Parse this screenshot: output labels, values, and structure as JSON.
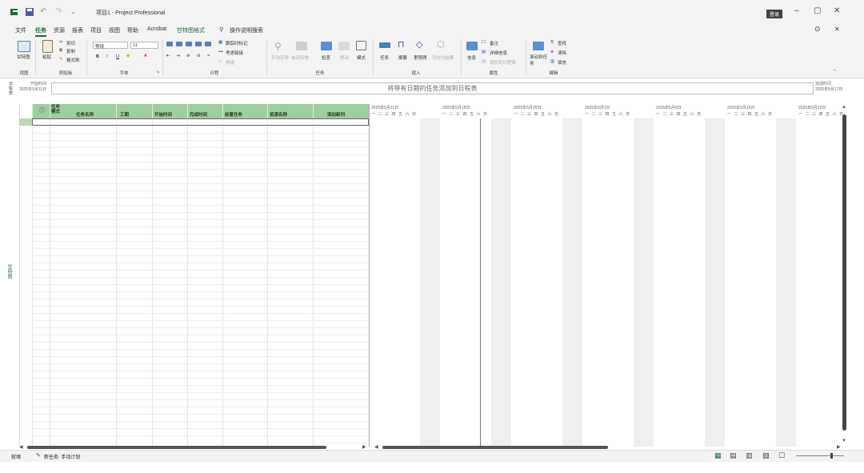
{
  "window": {
    "title": "项目1  -  Project Professional",
    "sign_in": "登录"
  },
  "menu": [
    "文件",
    "任务",
    "资源",
    "报表",
    "项目",
    "视图",
    "帮助",
    "Acrobat",
    "甘特图格式",
    "操作说明搜索"
  ],
  "active_menu": "任务",
  "ribbon": {
    "groups": {
      "view": "视图",
      "clipboard": "剪贴板",
      "font": "字体",
      "schedule": "日程",
      "tasks": "任务",
      "insert": "插入",
      "properties": "属性",
      "editing": "编辑"
    },
    "view_btn": "甘特图",
    "paste": "粘贴",
    "cut": "剪切",
    "copy": "复制",
    "format_painter": "格式刷",
    "font_name": "等线",
    "font_size": "11",
    "mark_on_track": "跟踪时标记",
    "respect_links": "考虑链接",
    "inactivate": "停用",
    "manual_schedule": "手动安排",
    "auto_schedule": "自动安排",
    "inspect": "检查",
    "move": "移动",
    "mode": "模式",
    "task": "任务",
    "summary": "摘要",
    "milestone": "里程碑",
    "deliverable": "可交付结果",
    "information": "信息",
    "notes": "备注",
    "details": "详细信息",
    "add_to_timeline": "添加到日程表",
    "scroll_to_task": "滚动到任务",
    "find": "查找",
    "clear": "清除",
    "fill": "填充"
  },
  "timeline": {
    "start_label": "开始时间",
    "start_date": "2025年5月11日",
    "finish_label": "完成时间",
    "finish_date": "2025年5月17日",
    "placeholder": "将带有日期的任务添加到日程表",
    "side_label": "日程表"
  },
  "grid": {
    "columns": [
      "任务模式",
      "任务名称",
      "工期",
      "开始时间",
      "完成时间",
      "前置任务",
      "资源名称",
      "添加新列"
    ],
    "rows": 45
  },
  "gantt": {
    "week_labels": [
      "2025年5月11日",
      "2025年5月18日",
      "2025年5月25日",
      "2025年6月1日",
      "2025年6月8日",
      "2025年6月15日",
      "2025年6月22日"
    ],
    "days": "一二三四五六日"
  },
  "sidebar_view_label": "甘特图",
  "status": {
    "ready": "就绪",
    "new_tasks": "新任务: 手动计划"
  },
  "colors": {
    "accent": "#1d6b3a",
    "header_green": "#9fce9f"
  }
}
